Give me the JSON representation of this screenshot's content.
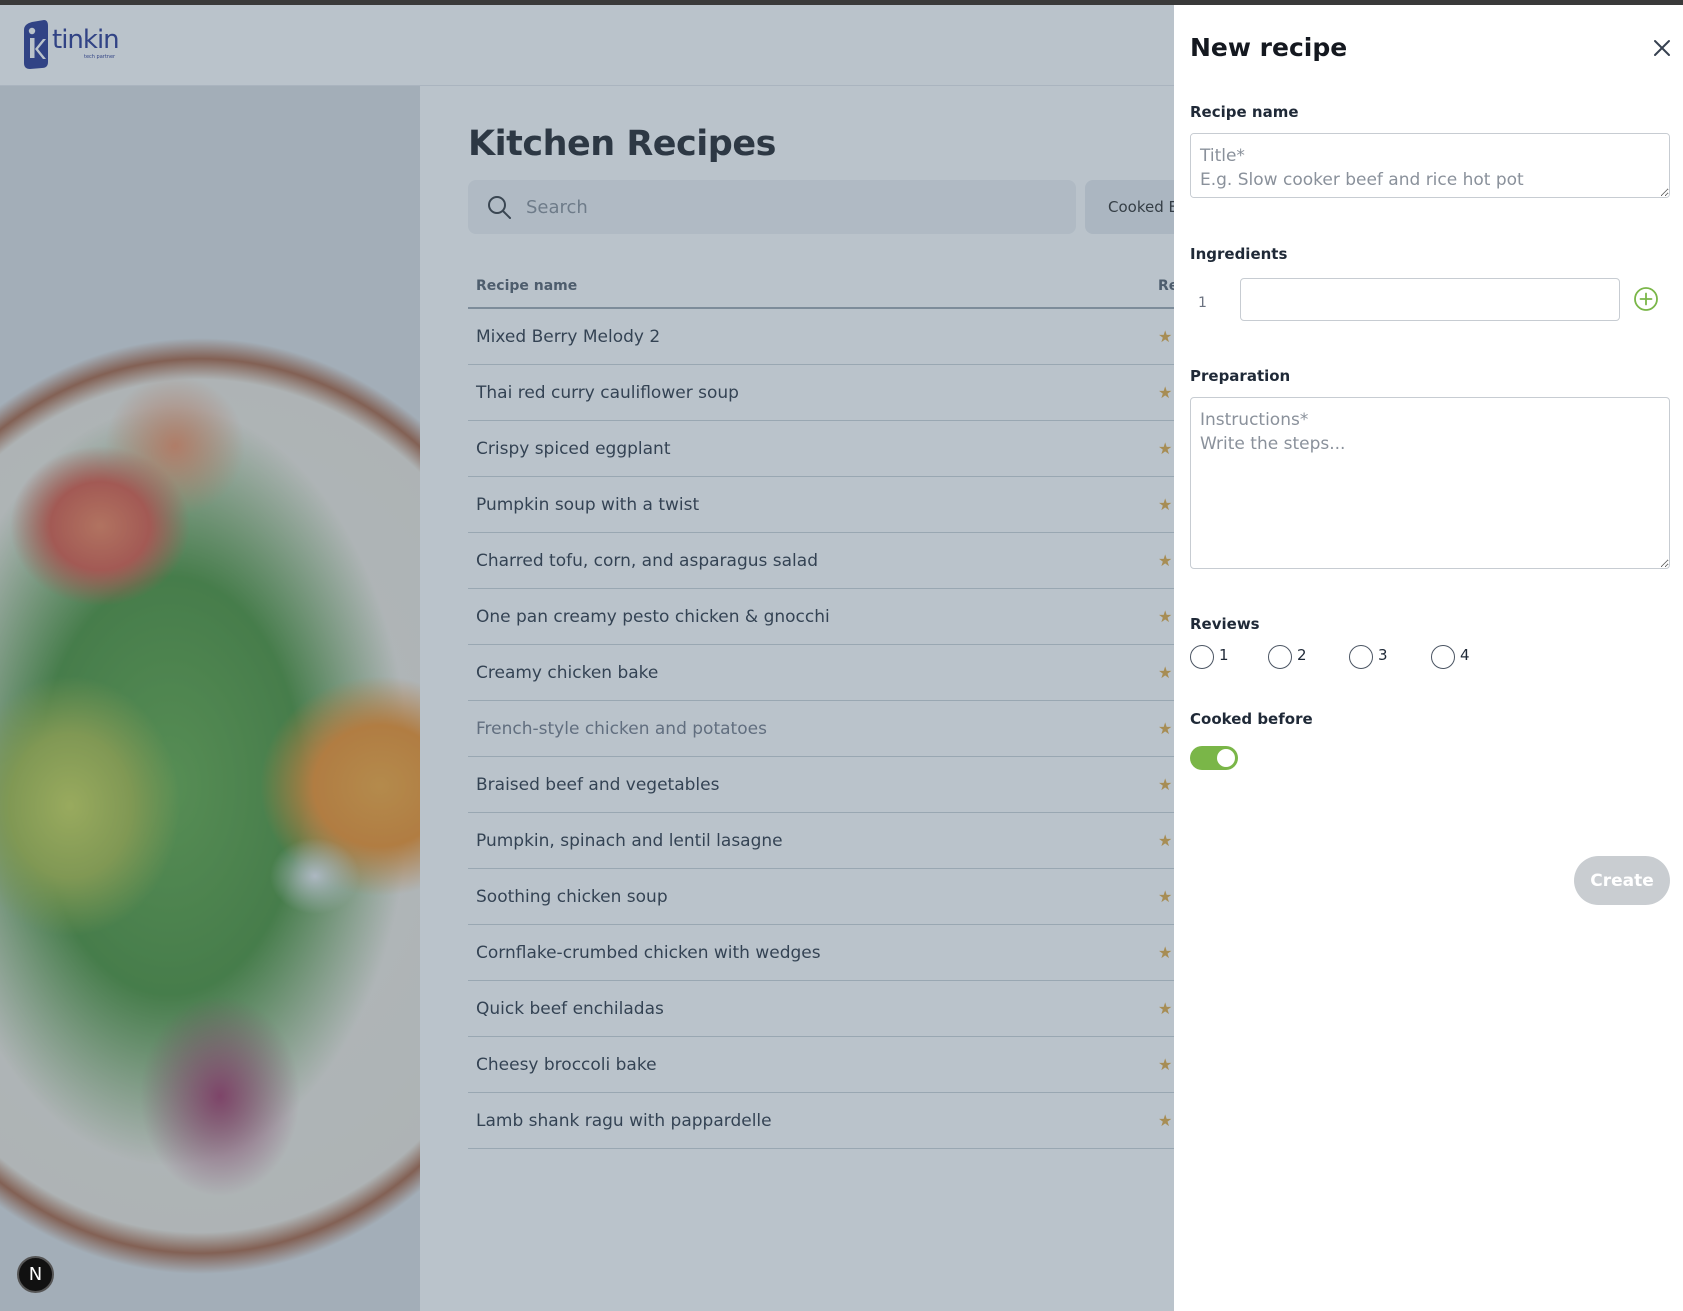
{
  "window": {
    "title": "Kitchen Recipes"
  },
  "header": {
    "logo_text": "tinkin",
    "logo_subtext": "tech partner"
  },
  "floating": {
    "badge_letter": "N"
  },
  "main": {
    "title": "Kitchen Recipes",
    "search": {
      "placeholder": "Search",
      "value": ""
    },
    "filter_label": "Cooked Before",
    "table": {
      "columns": [
        "Recipe name",
        "Reviews"
      ],
      "rows": [
        "Mixed Berry Melody 2",
        "Thai red curry cauliflower soup",
        "Crispy spiced eggplant",
        "Pumpkin soup with a twist",
        "Charred tofu, corn, and asparagus salad",
        "One pan creamy pesto chicken & gnocchi",
        "Creamy chicken bake",
        "French-style chicken and potatoes",
        "Braised beef and vegetables",
        "Pumpkin, spinach and lentil lasagne",
        "Soothing chicken soup",
        "Cornflake-crumbed chicken with wedges",
        "Quick beef enchiladas",
        "Cheesy broccoli bake",
        "Lamb shank ragu with pappardelle"
      ],
      "star_glyph": "★"
    }
  },
  "drawer": {
    "title": "New recipe",
    "close_icon": "close-icon",
    "recipe_name": {
      "label": "Recipe name",
      "placeholder": "Title*\nE.g. Slow cooker beef and rice hot pot",
      "value": ""
    },
    "ingredients": {
      "label": "Ingredients",
      "index": "1",
      "value": "",
      "add_icon": "plus-circle-icon"
    },
    "preparation": {
      "label": "Preparation",
      "placeholder": "Instructions*\nWrite the steps...",
      "value": ""
    },
    "reviews": {
      "label": "Reviews",
      "options": [
        "1",
        "2",
        "3",
        "4"
      ],
      "selected": null
    },
    "cooked_before": {
      "label": "Cooked before",
      "on": true
    },
    "create_label": "Create"
  },
  "colors": {
    "accent": "#7ab648",
    "overlay": "#53687c",
    "disabled_button": "#c9cdd1",
    "star": "#e0a53a",
    "brand": "#1c2a8a"
  }
}
